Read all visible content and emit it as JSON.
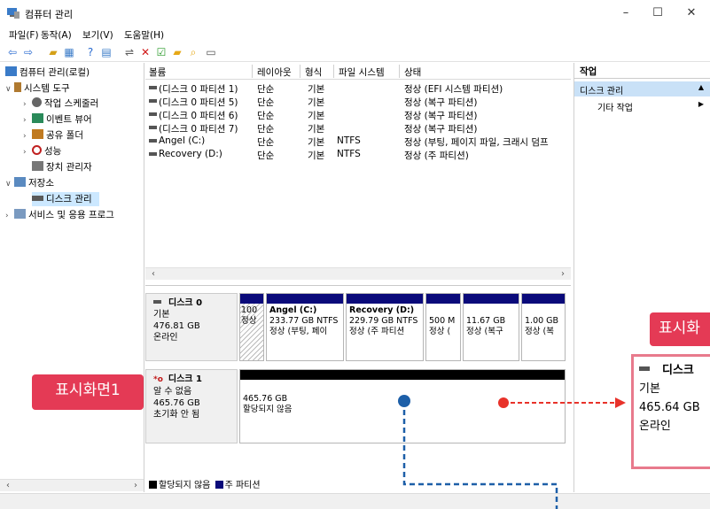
{
  "window": {
    "title": "컴퓨터 관리",
    "minimize": "–",
    "maximize": "☐",
    "close": "✕"
  },
  "menu": [
    "파일(F)",
    "동작(A)",
    "보기(V)",
    "도움말(H)"
  ],
  "toolbar": [
    "back-icon",
    "forward-icon",
    "up-folder-icon",
    "properties-icon",
    "help-icon",
    "view-icon",
    "connect-icon",
    "delete-icon",
    "check-icon",
    "folder-icon",
    "search-icon",
    "list-icon"
  ],
  "tree": {
    "root": "컴퓨터 관리(로컬)",
    "system_tools": "시스템 도구",
    "task_scheduler": "작업 스케줄러",
    "event_viewer": "이벤트 뷰어",
    "shared_folders": "공유 폴더",
    "performance": "성능",
    "device_manager": "장치 관리자",
    "storage": "저장소",
    "disk_management": "디스크 관리",
    "services": "서비스 및 응용 프로그"
  },
  "volume_table": {
    "headers": [
      "볼륨",
      "레이아웃",
      "형식",
      "파일 시스템",
      "상태"
    ],
    "rows": [
      [
        "(디스크 0 파티션 1)",
        "단순",
        "기본",
        "",
        "정상 (EFI 시스템 파티션)"
      ],
      [
        "(디스크 0 파티션 5)",
        "단순",
        "기본",
        "",
        "정상 (복구 파티션)"
      ],
      [
        "(디스크 0 파티션 6)",
        "단순",
        "기본",
        "",
        "정상 (복구 파티션)"
      ],
      [
        "(디스크 0 파티션 7)",
        "단순",
        "기본",
        "",
        "정상 (복구 파티션)"
      ],
      [
        "Angel (C:)",
        "단순",
        "기본",
        "NTFS",
        "정상 (부팅, 페이지 파일, 크래시 덤프"
      ],
      [
        "Recovery (D:)",
        "단순",
        "기본",
        "NTFS",
        "정상 (주 파티션)"
      ]
    ]
  },
  "disk0": {
    "name": "디스크 0",
    "type": "기본",
    "size": "476.81 GB",
    "status": "온라인",
    "partitions": [
      {
        "line1": "",
        "line2": "100",
        "line3": "정상"
      },
      {
        "line1": "Angel  (C:)",
        "line2": "233.77 GB NTFS",
        "line3": "정상 (부팅, 페이"
      },
      {
        "line1": "Recovery  (D:)",
        "line2": "229.79 GB NTFS",
        "line3": "정상 (주 파티션"
      },
      {
        "line1": "",
        "line2": "500 M",
        "line3": "정상 ("
      },
      {
        "line1": "",
        "line2": "11.67 GB",
        "line3": "정상 (복구"
      },
      {
        "line1": "",
        "line2": "1.00 GB",
        "line3": "정상 (복"
      }
    ]
  },
  "disk1": {
    "name": "디스크 1",
    "type": "알 수 없음",
    "size": "465.76 GB",
    "status": "초기화 안 됨",
    "partition_size": "465.76 GB",
    "partition_status": "할당되지 않음"
  },
  "legend": {
    "unallocated": "할당되지 않음",
    "primary": "주 파티션"
  },
  "actions": {
    "title": "작업",
    "section": "디스크 관리",
    "more": "기타 작업"
  },
  "annotations": {
    "badge_left": "표시화면1",
    "badge_right": "표시화",
    "callout": {
      "name": "디스크",
      "type": "기본",
      "size": "465.64 GB",
      "status": "온라인"
    }
  },
  "colors": {
    "primary_partition": "#0a0a7a",
    "unallocated": "#000000",
    "badge": "#e43a55",
    "red_arrow": "#e8322a",
    "blue_line": "#1d5fa8"
  }
}
